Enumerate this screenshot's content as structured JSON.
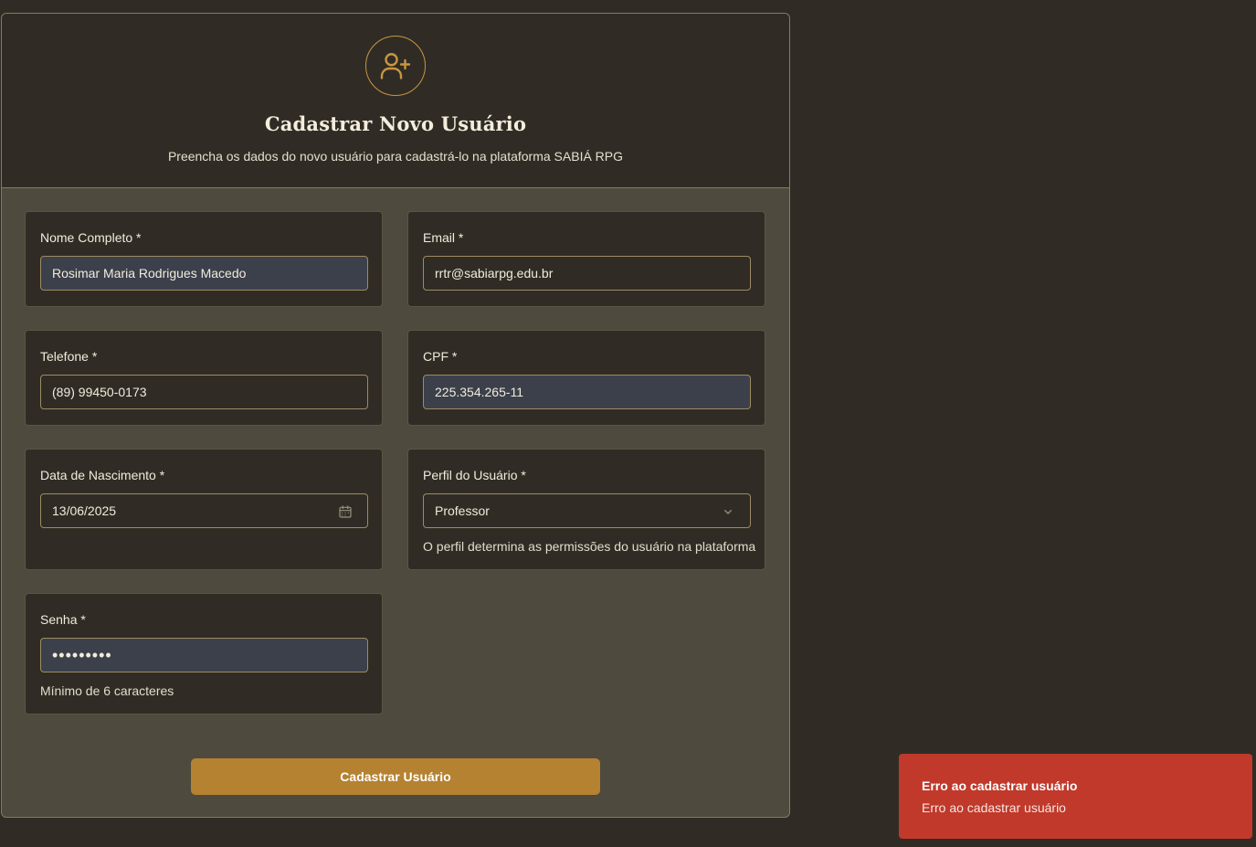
{
  "colors": {
    "background": "#302c25",
    "card_body": "#4e4a3e",
    "accent": "#b58232",
    "filled_input": "#3b404b",
    "error": "#c0392b"
  },
  "header": {
    "icon": "user-plus-icon",
    "title": "Cadastrar Novo Usuário",
    "subtitle": "Preencha os dados do novo usuário para cadastrá-lo na plataforma SABIÁ RPG"
  },
  "form": {
    "full_name": {
      "label": "Nome Completo *",
      "value": "Rosimar Maria Rodrigues Macedo"
    },
    "email": {
      "label": "Email *",
      "value": "rrtr@sabiarpg.edu.br"
    },
    "phone": {
      "label": "Telefone *",
      "value": "(89) 99450-0173"
    },
    "cpf": {
      "label": "CPF *",
      "value": "225.354.265-11"
    },
    "birth_date": {
      "label": "Data de Nascimento *",
      "value": "13/06/2025",
      "icon": "calendar-icon"
    },
    "role": {
      "label": "Perfil do Usuário *",
      "value": "Professor",
      "icon": "chevron-down-icon",
      "hint": "O perfil determina as permissões do usuário na plataforma"
    },
    "password": {
      "label": "Senha *",
      "value": "•••••••••",
      "hint": "Mínimo de 6 caracteres"
    },
    "submit_label": "Cadastrar Usuário"
  },
  "toast": {
    "title": "Erro ao cadastrar usuário",
    "description": "Erro ao cadastrar usuário"
  }
}
